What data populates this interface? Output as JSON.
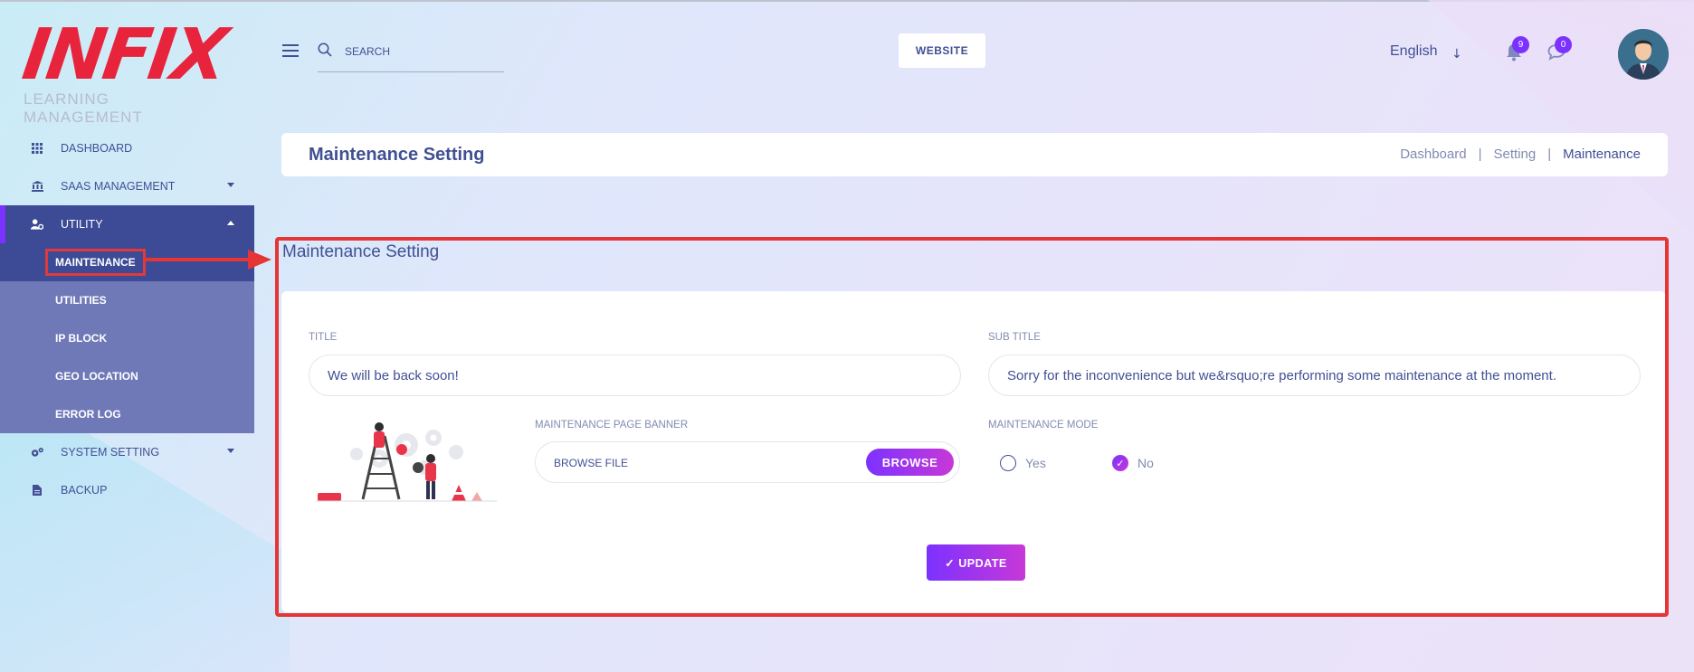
{
  "brand": {
    "logo_text": "INFIX",
    "logo_subtitle": "LEARNING MANAGEMENT"
  },
  "sidebar": {
    "items": [
      {
        "label": "DASHBOARD",
        "icon": "grid-icon"
      },
      {
        "label": "SAAS MANAGEMENT",
        "icon": "bank-icon"
      },
      {
        "label": "UTILITY",
        "icon": "user-gear-icon"
      },
      {
        "label": "SYSTEM SETTING",
        "icon": "gears-icon"
      },
      {
        "label": "BACKUP",
        "icon": "file-icon"
      }
    ],
    "utility_sub": [
      "MAINTENANCE",
      "UTILITIES",
      "IP BLOCK",
      "GEO LOCATION",
      "ERROR LOG"
    ]
  },
  "header": {
    "search_placeholder": "SEARCH",
    "website_label": "WEBSITE",
    "language": "English",
    "notification_count": "9",
    "message_count": "0"
  },
  "page": {
    "title": "Maintenance Setting",
    "breadcrumb": [
      "Dashboard",
      "Setting",
      "Maintenance"
    ],
    "section_title": "Maintenance Setting"
  },
  "form": {
    "title_label": "TITLE",
    "title_value": "We will be back soon!",
    "subtitle_label": "SUB TITLE",
    "subtitle_value": "Sorry for the inconvenience but we&rsquo;re performing some maintenance at the moment.",
    "banner_label": "MAINTENANCE PAGE BANNER",
    "browse_placeholder": "BROWSE FILE",
    "browse_button": "BROWSE",
    "mode_label": "MAINTENANCE MODE",
    "mode_options": [
      "Yes",
      "No"
    ],
    "mode_selected": "No",
    "update_button": "✓ UPDATE"
  },
  "colors": {
    "accent": "#7c32ff",
    "accent2": "#c738d8",
    "primary": "#415094",
    "highlight": "#e53535"
  }
}
